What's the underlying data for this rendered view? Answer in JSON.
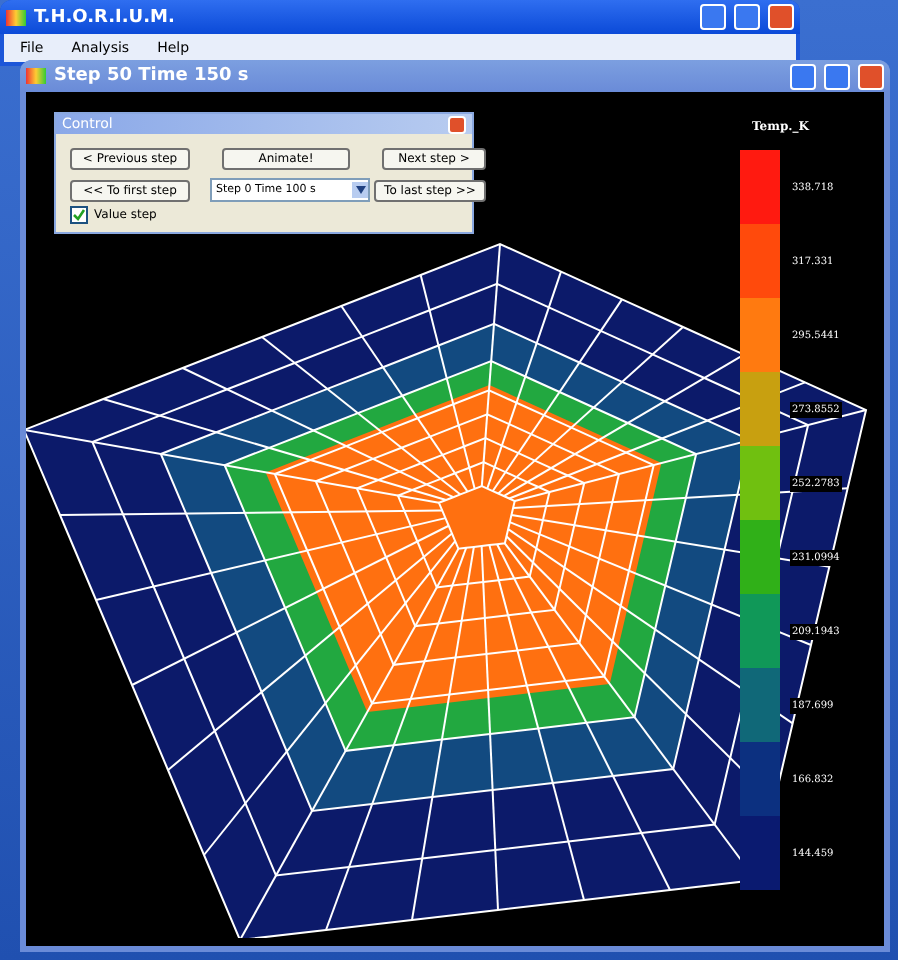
{
  "app_window": {
    "title": "T.H.O.R.I.U.M.",
    "menu": [
      "File",
      "Analysis",
      "Help"
    ]
  },
  "child_window": {
    "title": "Step 50  Time 150 s"
  },
  "control": {
    "title": "Control",
    "buttons": [
      {
        "label": "< Previous step",
        "kind": "button"
      },
      {
        "label": "Animate!",
        "kind": "button"
      },
      {
        "label": "Next step >",
        "kind": "button"
      },
      {
        "label": "<< To first step",
        "kind": "button"
      },
      {
        "label": "Step 0  Time  100 s",
        "kind": "select"
      },
      {
        "label": "To last step >>",
        "kind": "button"
      }
    ],
    "checkbox": {
      "label": "Value step",
      "checked": true
    }
  },
  "legend": {
    "title": "Temp._K",
    "segments": [
      {
        "label": "338.718",
        "color": "#ff1a10"
      },
      {
        "label": "317.331",
        "color": "#ff4a0c"
      },
      {
        "label": "295.5441",
        "color": "#ff7a10"
      },
      {
        "label": "273.8552",
        "color": "#c8a010"
      },
      {
        "label": "252.2783",
        "color": "#70c010"
      },
      {
        "label": "231.0994",
        "color": "#30b018"
      },
      {
        "label": "209.1943",
        "color": "#109858"
      },
      {
        "label": "187.699",
        "color": "#106878"
      },
      {
        "label": "166.832",
        "color": "#0c3080"
      },
      {
        "label": "144.459",
        "color": "#0a1a70"
      }
    ]
  }
}
